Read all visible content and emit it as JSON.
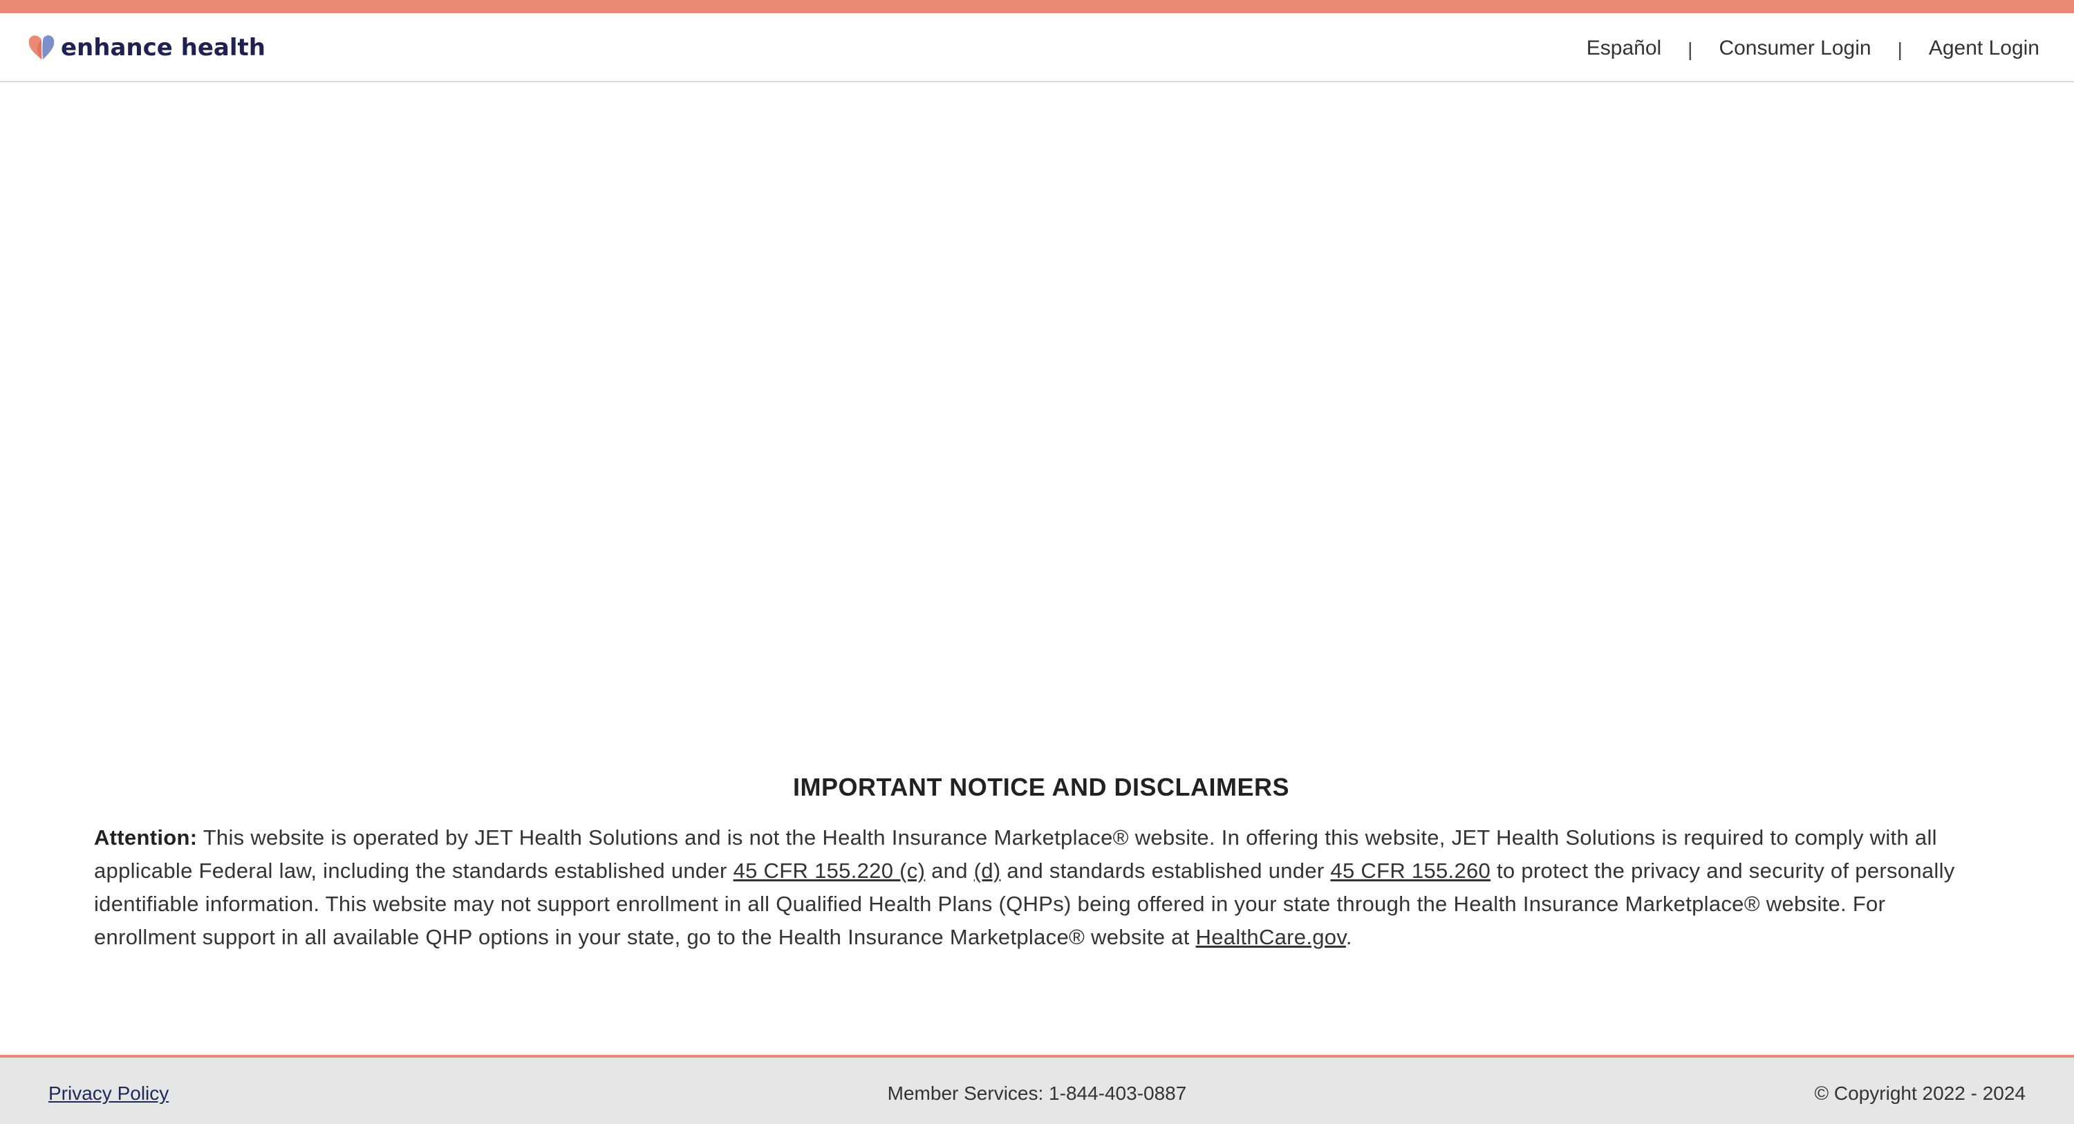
{
  "brand": {
    "name": "enhance health",
    "colors": {
      "accent": "#e98a76",
      "logo_text": "#1f2150",
      "logo_blue": "#7d8fc8",
      "footer_bg": "#e5e6e6"
    }
  },
  "header": {
    "nav": [
      {
        "label": "Español"
      },
      {
        "label": "Consumer Login"
      },
      {
        "label": "Agent Login"
      }
    ],
    "separator": "|"
  },
  "notice": {
    "title": "IMPORTANT NOTICE AND DISCLAIMERS",
    "attention_label": "Attention:",
    "text_1": " This website is operated by JET Health Solutions and is not the Health Insurance Marketplace® website. In offering this website, JET Health Solutions is required to comply with all applicable Federal law, including the standards established under ",
    "link_1": "45 CFR 155.220 (c)",
    "text_2": " and ",
    "link_2": "(d)",
    "text_3": " and standards established under ",
    "link_3": "45 CFR 155.260",
    "text_4": " to protect the privacy and security of personally identifiable information. This website may not support enrollment in all Qualified Health Plans (QHPs) being offered in your state through the Health Insurance Marketplace® website. For enrollment support in all available QHP options in your state, go to the Health Insurance Marketplace® website at ",
    "link_4": "HealthCare.gov",
    "text_5": "."
  },
  "footer": {
    "privacy_label": "Privacy Policy",
    "member_services": "Member Services: 1-844-403-0887",
    "copyright": "© Copyright 2022 - 2024"
  }
}
